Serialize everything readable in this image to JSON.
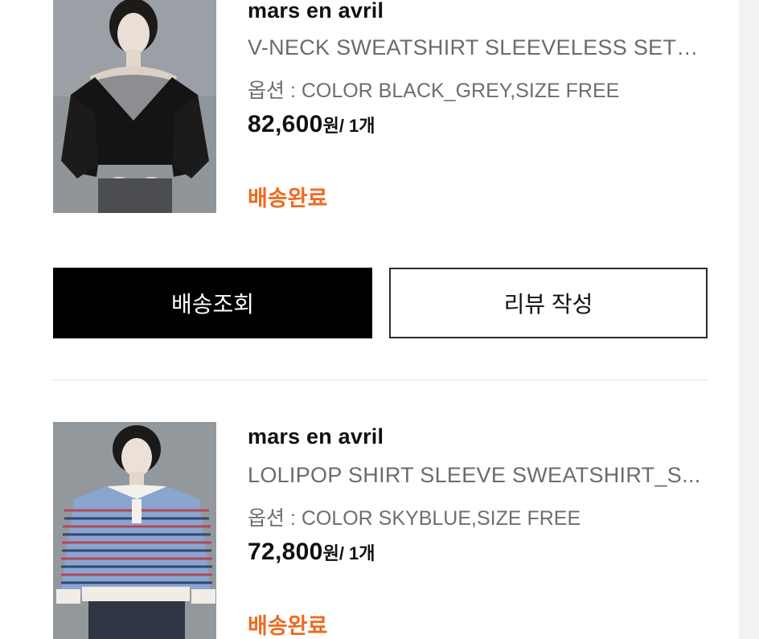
{
  "orders": [
    {
      "brand": "mars en avril",
      "product_name": "V-NECK SWEATSHIRT SLEEVELESS SET_...",
      "option": "옵션 : COLOR BLACK_GREY,SIZE FREE",
      "price": "82,600",
      "price_unit": "원",
      "quantity": "/ 1개",
      "status": "배송완료",
      "status_color": "#f06a1e"
    },
    {
      "brand": "mars en avril",
      "product_name": "LOLIPOP SHIRT SLEEVE SWEATSHIRT_S...",
      "option": "옵션 : COLOR SKYBLUE,SIZE FREE",
      "price": "72,800",
      "price_unit": "원",
      "quantity": "/ 1개",
      "status": "배송완료",
      "status_color": "#f06a1e"
    }
  ],
  "actions": {
    "track_delivery": "배송조회",
    "write_review": "리뷰 작성"
  }
}
